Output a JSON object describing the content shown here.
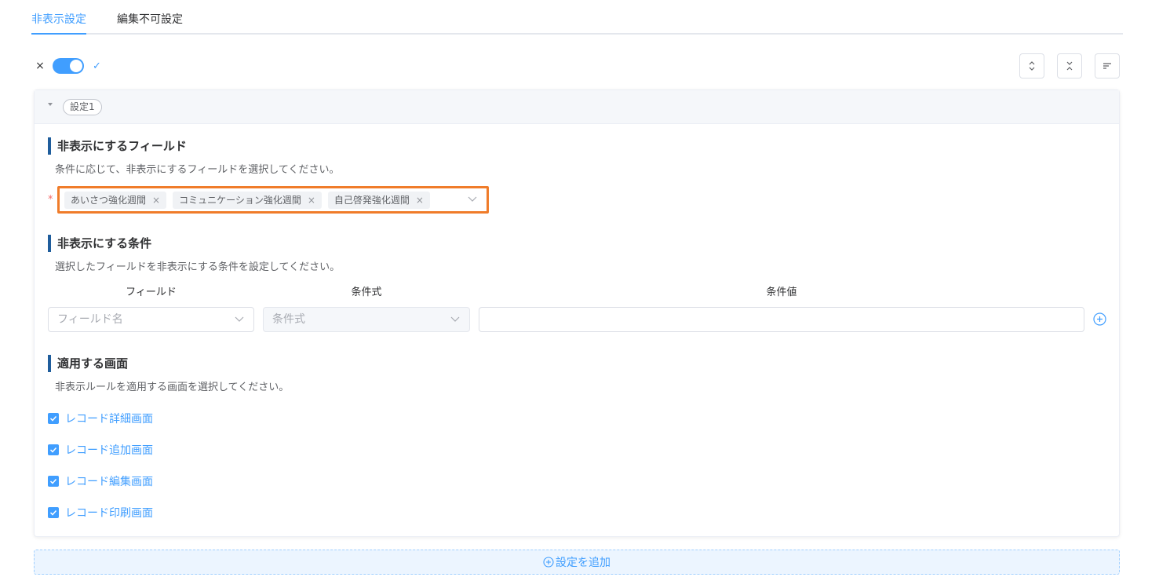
{
  "tabs": [
    {
      "label": "非表示設定"
    },
    {
      "label": "編集不可設定"
    }
  ],
  "toggle": {
    "off_symbol": "×",
    "on_symbol": "✓"
  },
  "setting": {
    "tag": "設定1",
    "fields_section": {
      "title": "非表示にするフィールド",
      "description": "条件に応じて、非表示にするフィールドを選択してください。",
      "required_mark": "*",
      "selected": [
        "あいさつ強化週間",
        "コミュニケーション強化週間",
        "自己啓発強化週間"
      ]
    },
    "condition_section": {
      "title": "非表示にする条件",
      "description": "選択したフィールドを非表示にする条件を設定してください。",
      "columns": [
        "フィールド",
        "条件式",
        "条件値"
      ],
      "field_placeholder": "フィールド名",
      "operator_placeholder": "条件式",
      "value": ""
    },
    "screen_section": {
      "title": "適用する画面",
      "description": "非表示ルールを適用する画面を選択してください。",
      "options": [
        {
          "label": "レコード詳細画面",
          "checked": true
        },
        {
          "label": "レコード追加画面",
          "checked": true
        },
        {
          "label": "レコード編集画面",
          "checked": true
        },
        {
          "label": "レコード印刷画面",
          "checked": true
        }
      ]
    }
  },
  "add_setting_label": "設定を追加",
  "colors": {
    "accent": "#409eff",
    "highlight": "#f07c2a",
    "section_bar": "#1f5d9c"
  }
}
